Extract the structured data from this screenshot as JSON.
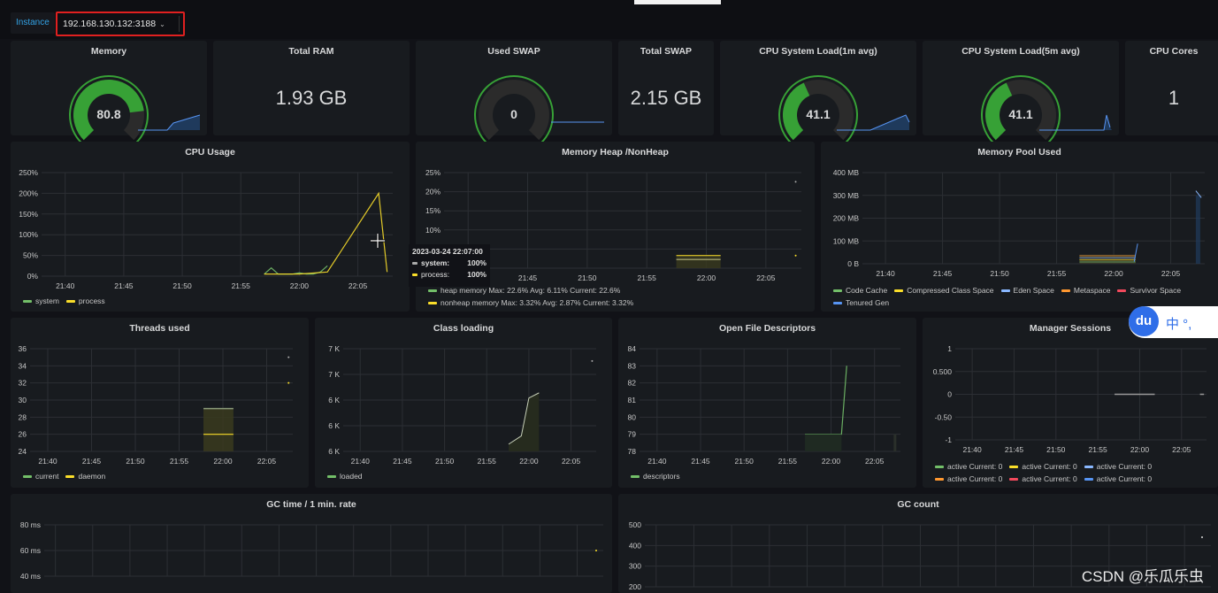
{
  "topbar": {
    "variable_label": "Instance",
    "variable_value": "192.168.130.132:3188",
    "chevron_icon": "chevron-down-icon"
  },
  "stats": [
    {
      "id": "memory",
      "title": "Memory",
      "type": "gauge",
      "value": "80.8",
      "percent": 80.8
    },
    {
      "id": "total-ram",
      "title": "Total RAM",
      "type": "stat",
      "value": "1.93 GB"
    },
    {
      "id": "used-swap",
      "title": "Used SWAP",
      "type": "gauge",
      "value": "0",
      "percent": 0
    },
    {
      "id": "total-swap",
      "title": "Total SWAP",
      "type": "stat",
      "value": "2.15 GB"
    },
    {
      "id": "cpu-load-1m",
      "title": "CPU System Load(1m avg)",
      "type": "gauge",
      "value": "41.1",
      "percent": 41.1
    },
    {
      "id": "cpu-load-5m",
      "title": "CPU System Load(5m avg)",
      "type": "gauge",
      "value": "41.1",
      "percent": 41.1
    },
    {
      "id": "cpu-cores",
      "title": "CPU Cores",
      "type": "stat",
      "value": "1"
    }
  ],
  "x_ticks": [
    "21:40",
    "21:45",
    "21:50",
    "21:55",
    "22:00",
    "22:05"
  ],
  "tooltip": {
    "time": "2023-03-24 22:07:00",
    "rows": [
      {
        "label": "system:",
        "value": "100%"
      },
      {
        "label": "process:",
        "value": "100%"
      }
    ]
  },
  "colors": {
    "green": "#73bf69",
    "yellow": "#fade2a",
    "light_blue": "#8ab8ff",
    "orange": "#ff9830",
    "red": "#f2495c",
    "blue": "#5794f2",
    "gauge_green": "#37a136",
    "gauge_track": "#2b2b2b"
  },
  "chart_data": [
    {
      "id": "cpu-usage",
      "type": "line",
      "title": "CPU Usage",
      "yticks": [
        "250%",
        "200%",
        "150%",
        "100%",
        "50%",
        "0%"
      ],
      "ylim": [
        0,
        250
      ],
      "series": [
        {
          "name": "system",
          "color": "#73bf69",
          "points": [
            [
              21.95,
              5
            ],
            [
              21.96,
              20
            ],
            [
              21.97,
              5
            ],
            [
              21.99,
              5
            ],
            [
              22.0,
              8
            ],
            [
              22.01,
              5
            ],
            [
              22.02,
              5
            ],
            [
              22.03,
              10
            ],
            [
              22.04,
              25
            ]
          ]
        },
        {
          "name": "process",
          "color": "#fade2a",
          "points": [
            [
              21.95,
              5
            ],
            [
              21.97,
              5
            ],
            [
              22.0,
              5
            ],
            [
              22.04,
              10
            ],
            [
              22.113,
              200
            ],
            [
              22.125,
              10
            ]
          ]
        }
      ],
      "legend": [
        "system",
        "process"
      ]
    },
    {
      "id": "memory-heap",
      "type": "line",
      "title": "Memory Heap /NonHeap",
      "yticks": [
        "25%",
        "20%",
        "15%",
        "10%",
        "5%",
        "0%"
      ],
      "ylim": [
        0,
        25
      ],
      "series": [
        {
          "name": "heap memory",
          "color": "#73bf69",
          "max": "22.6%",
          "avg": "6.11%",
          "current": "22.6%"
        },
        {
          "name": "nonheap memory",
          "color": "#fade2a",
          "max": "3.32%",
          "avg": "2.87%",
          "current": "3.32%"
        }
      ],
      "legend": [
        "heap memory  Max: 22.6%  Avg: 6.11%  Current: 22.6%",
        "nonheap memory  Max: 3.32%  Avg: 2.87%  Current: 3.32%"
      ]
    },
    {
      "id": "memory-pool",
      "type": "area",
      "title": "Memory Pool Used",
      "yticks": [
        "400 MB",
        "300 MB",
        "200 MB",
        "100 MB",
        "0 B"
      ],
      "ylim": [
        0,
        400
      ],
      "legend": [
        {
          "name": "Code Cache",
          "color": "#73bf69"
        },
        {
          "name": "Compressed Class Space",
          "color": "#fade2a"
        },
        {
          "name": "Eden Space",
          "color": "#8ab8ff"
        },
        {
          "name": "Metaspace",
          "color": "#ff9830"
        },
        {
          "name": "Survivor Space",
          "color": "#f2495c"
        },
        {
          "name": "Tenured Gen",
          "color": "#5794f2"
        }
      ]
    },
    {
      "id": "threads-used",
      "type": "line",
      "title": "Threads used",
      "yticks": [
        "36",
        "34",
        "32",
        "30",
        "28",
        "26",
        "24"
      ],
      "ylim": [
        24,
        36
      ],
      "series": [
        {
          "name": "current",
          "color": "#73bf69",
          "value": 29
        },
        {
          "name": "daemon",
          "color": "#fade2a",
          "value": 26
        }
      ],
      "legend": [
        "current",
        "daemon"
      ]
    },
    {
      "id": "class-loading",
      "type": "line",
      "title": "Class loading",
      "yticks": [
        "7 K",
        "7 K",
        "6 K",
        "6 K",
        "6 K"
      ],
      "series": [
        {
          "name": "loaded",
          "color": "#73bf69"
        }
      ],
      "legend": [
        "loaded"
      ]
    },
    {
      "id": "open-file-descriptors",
      "type": "line",
      "title": "Open File Descriptors",
      "yticks": [
        "84",
        "83",
        "82",
        "81",
        "80",
        "79",
        "78"
      ],
      "ylim": [
        78,
        84
      ],
      "series": [
        {
          "name": "descriptors",
          "color": "#73bf69",
          "points": [
            [
              21.95,
              79
            ],
            [
              22.02,
              79
            ],
            [
              22.03,
              83
            ]
          ]
        }
      ],
      "legend": [
        "descriptors"
      ]
    },
    {
      "id": "manager-sessions",
      "type": "line",
      "title": "Manager Sessions",
      "yticks": [
        "1",
        "0.500",
        "0",
        "-0.50",
        "-1"
      ],
      "ylim": [
        -1,
        1
      ],
      "legend": [
        {
          "name": "active  Current: 0",
          "color": "#73bf69"
        },
        {
          "name": "active  Current: 0",
          "color": "#fade2a"
        },
        {
          "name": "active  Current: 0",
          "color": "#8ab8ff"
        },
        {
          "name": "active  Current: 0",
          "color": "#ff9830"
        },
        {
          "name": "active  Current: 0",
          "color": "#f2495c"
        },
        {
          "name": "active  Current: 0",
          "color": "#5794f2"
        }
      ]
    },
    {
      "id": "gc-time",
      "type": "line",
      "title": "GC time / 1 min. rate",
      "yticks": [
        "80 ms",
        "60 ms",
        "40 ms"
      ]
    },
    {
      "id": "gc-count",
      "type": "line",
      "title": "GC count",
      "yticks": [
        "500",
        "400",
        "300",
        "200"
      ]
    }
  ],
  "overlay": {
    "du_logo": "du",
    "du_text": "中 °,",
    "watermark": "CSDN @乐瓜乐虫"
  }
}
